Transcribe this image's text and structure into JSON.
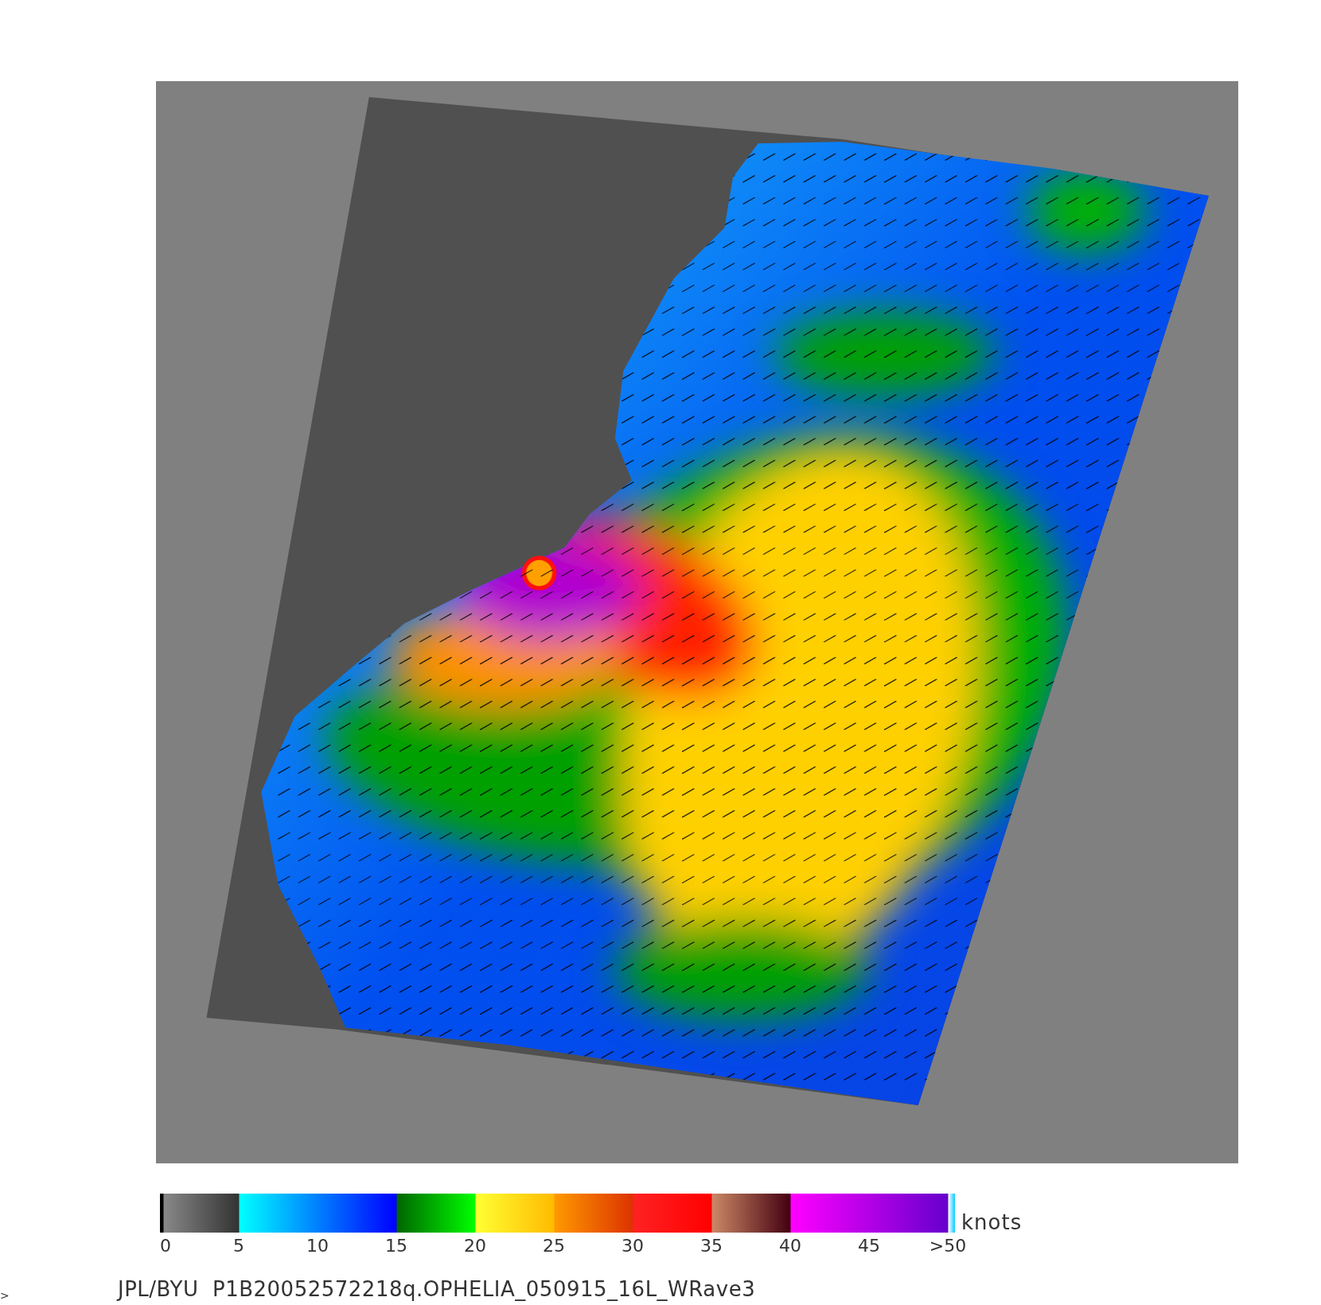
{
  "colorbar": {
    "ticks": [
      "0",
      "5",
      "10",
      "15",
      "20",
      "25",
      "30",
      "35",
      "40",
      "45",
      ">50"
    ],
    "unit": "knots"
  },
  "caption": "JPL/BYU  P1B20052572218q.OPHELIA_050915_16L_WRave3",
  "edge_mark": ">"
}
